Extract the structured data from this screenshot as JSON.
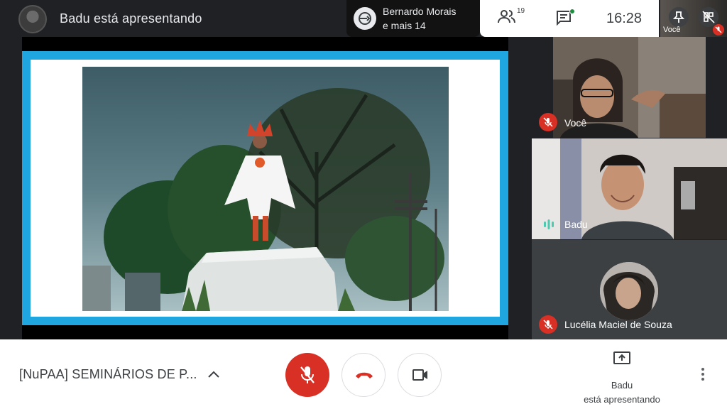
{
  "header": {
    "presenter_title": "Badu está apresentando"
  },
  "joined": {
    "line1": "Bernardo Morais",
    "line2": "e mais 14"
  },
  "info": {
    "people_count": "19",
    "time": "16:28"
  },
  "self_thumb": {
    "label": "Você"
  },
  "tiles": [
    {
      "name": "Você",
      "muted": true
    },
    {
      "name": "Badu",
      "muted": false,
      "speaking": true
    },
    {
      "name": "Lucélia Maciel de Souza",
      "muted": true
    }
  ],
  "footer": {
    "meeting_title": "[NuPAA] SEMINÁRIOS DE P...",
    "present_line1": "Badu",
    "present_line2": "está apresentando"
  },
  "colors": {
    "slide_border": "#1fa5e0",
    "mute_red": "#d93025",
    "speaking_teal": "#4ec9b0",
    "chat_dot": "#1e8e3e"
  },
  "icons": {
    "people": "people-icon",
    "chat": "chat-icon",
    "pin": "pin-icon",
    "mic_off": "mic-off-icon",
    "hangup": "call-end-icon",
    "camera": "videocam-icon",
    "present": "present-screen-icon",
    "more": "more-vert-icon"
  }
}
